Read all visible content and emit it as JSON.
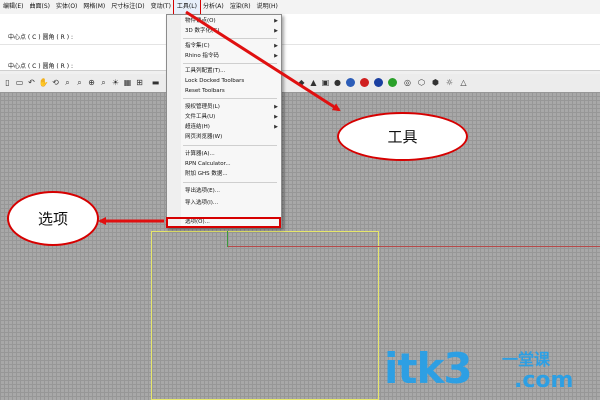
{
  "menubar": {
    "items": [
      {
        "label": "曲面(S)"
      },
      {
        "label": "实体(O)"
      },
      {
        "label": "网格(M)"
      },
      {
        "label": "尺寸标注(D)"
      },
      {
        "label": "变动(T)"
      },
      {
        "label": "工具(L)"
      },
      {
        "label": "分析(A)"
      },
      {
        "label": "渲染(R)"
      },
      {
        "label": "说明(H)"
      }
    ],
    "prefix": "编辑(E)"
  },
  "command": {
    "line1": "中心点 ( C )   圆角 ( R ) :",
    "line2": "中心点 ( C )   圆角 ( R ) :"
  },
  "tools_menu": {
    "items": [
      {
        "label": "物件锁点(O)",
        "submenu": true
      },
      {
        "label": "3D 数字化(G)",
        "submenu": true
      },
      {
        "label": "指令集(C)",
        "submenu": true
      },
      {
        "label": "Rhino 指令码",
        "submenu": true
      },
      {
        "label": "工具列配置(T)...",
        "submenu": false
      },
      {
        "label": "Lock Docked Toolbars",
        "submenu": false
      },
      {
        "label": "Reset Toolbars",
        "submenu": false
      },
      {
        "label": "授权管理员(L)",
        "submenu": true
      },
      {
        "label": "文件工具(U)",
        "submenu": true
      },
      {
        "label": "超连结(H)",
        "submenu": true
      },
      {
        "label": "网页浏览器(W)",
        "submenu": false
      },
      {
        "label": "计算器(A)...",
        "submenu": false
      },
      {
        "label": "RPN Calculator...",
        "submenu": false
      },
      {
        "label": "附加 GHS 数据...",
        "submenu": false
      },
      {
        "label": "导出选项(E)...",
        "submenu": false
      },
      {
        "label": "导入选项(I)...",
        "submenu": false
      },
      {
        "label": "选项(O)...",
        "submenu": false
      }
    ]
  },
  "callouts": {
    "tools": "工具",
    "options": "选项"
  },
  "watermark": {
    "text": "itk3",
    "cn": "一堂课",
    "com": ".com"
  },
  "colors": {
    "accent_red": "#d60000",
    "viewport_gray": "#a8a8a8",
    "watermark_blue": "#2d9fe3"
  }
}
